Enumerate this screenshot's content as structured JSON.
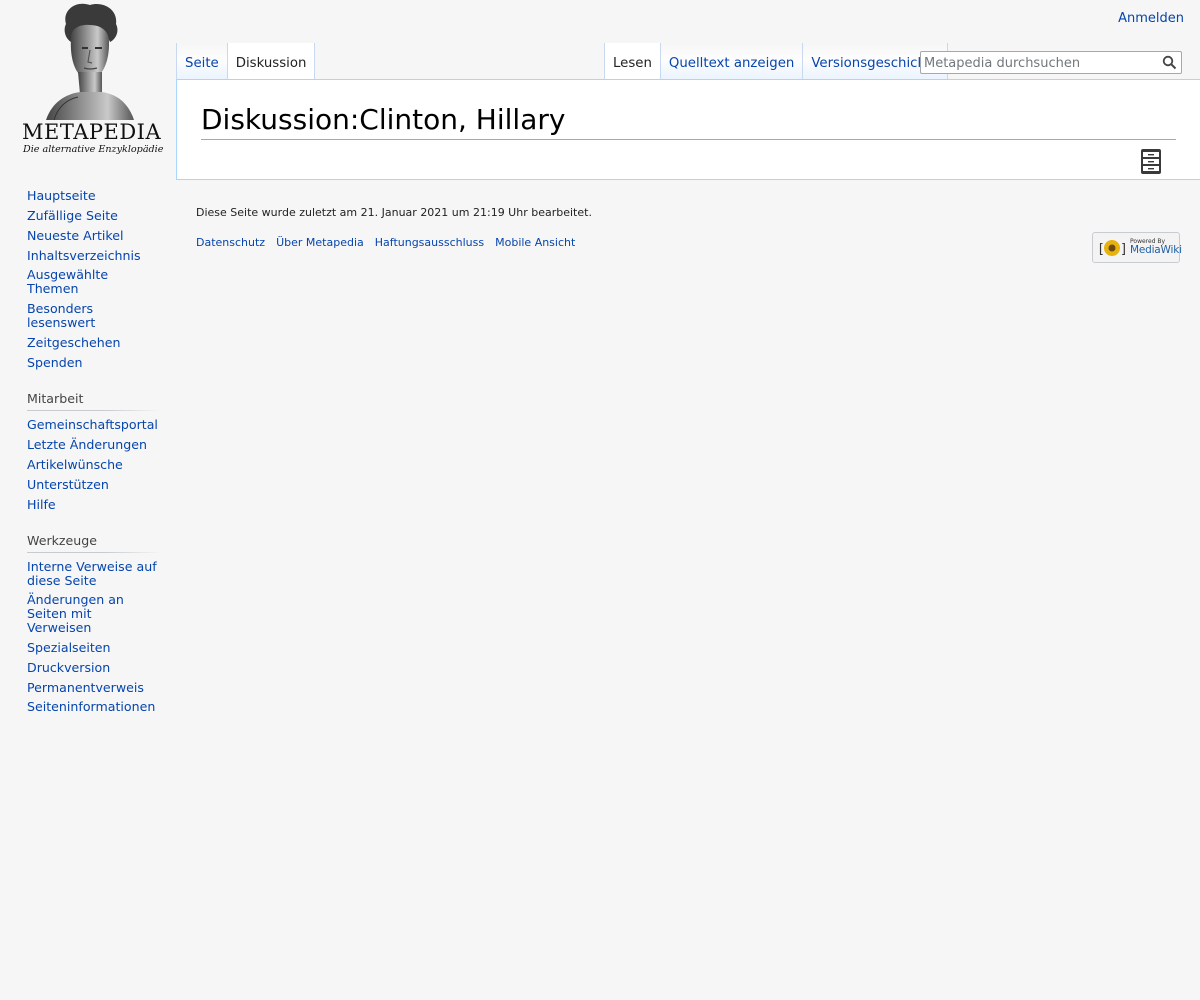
{
  "personal": {
    "login": "Anmelden"
  },
  "logo": {
    "wordmark": "METAPEDIA",
    "tagline": "Die alternative Enzyklopädie"
  },
  "tabs": {
    "left": [
      {
        "label": "Seite",
        "selected": false
      },
      {
        "label": "Diskussion",
        "selected": true
      }
    ],
    "right": [
      {
        "label": "Lesen",
        "selected": true
      },
      {
        "label": "Quelltext anzeigen",
        "selected": false
      },
      {
        "label": "Versionsgeschichte",
        "selected": false
      }
    ]
  },
  "search": {
    "placeholder": "Metapedia durchsuchen",
    "value": "",
    "button_icon": "magnifier-icon"
  },
  "content": {
    "title": "Diskussion:Clinton, Hillary",
    "archive_icon": "archive-cabinet-icon"
  },
  "sidebar": {
    "navigation": {
      "items": [
        "Hauptseite",
        "Zufällige Seite",
        "Neueste Artikel",
        "Inhaltsverzeichnis",
        "Ausgewählte Themen",
        "Besonders lesenswert",
        "Zeitgeschehen",
        "Spenden"
      ]
    },
    "mitarbeit": {
      "heading": "Mitarbeit",
      "items": [
        "Gemeinschaftsportal",
        "Letzte Änderungen",
        "Artikelwünsche",
        "Unterstützen",
        "Hilfe"
      ]
    },
    "werkzeuge": {
      "heading": "Werkzeuge",
      "items": [
        "Interne Verweise auf diese Seite",
        "Änderungen an Seiten mit Verweisen",
        "Spezialseiten",
        "Druckversion",
        "Permanentverweis",
        "Seiteninformationen"
      ]
    }
  },
  "footer": {
    "info": "Diese Seite wurde zuletzt am 21. Januar 2021 um 21:19 Uhr bearbeitet.",
    "places": [
      "Datenschutz",
      "Über Metapedia",
      "Haftungsausschluss",
      "Mobile Ansicht"
    ],
    "powered_by": {
      "small": "Powered By",
      "name": "MediaWiki"
    }
  },
  "colors": {
    "link": "#0645ad",
    "background": "#f6f6f6",
    "content_border": "#a7d7f9"
  }
}
